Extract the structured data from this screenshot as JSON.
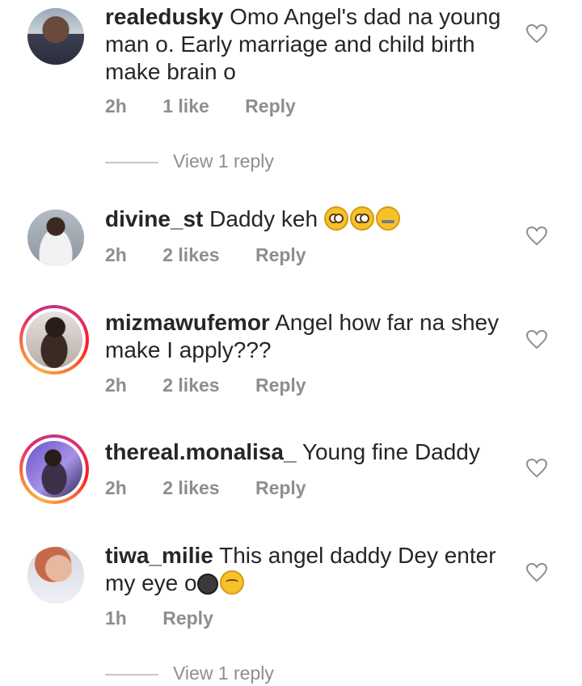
{
  "comments": [
    {
      "username": "realedusky",
      "text": "Omo Angel's dad na young man o. Early marriage and child birth make brain o",
      "time": "2h",
      "likes": "1 like",
      "reply": "Reply",
      "view_replies": "View 1 reply",
      "avatar_ring": false
    },
    {
      "username": "divine_st",
      "text": "Daddy keh",
      "emojis": [
        "flushed-face",
        "flushed-face",
        "zipper-mouth-face"
      ],
      "time": "2h",
      "likes": "2 likes",
      "reply": "Reply",
      "avatar_ring": false
    },
    {
      "username": "mizmawufemor",
      "text": "Angel how far na shey make I apply???",
      "time": "2h",
      "likes": "2 likes",
      "reply": "Reply",
      "avatar_ring": true
    },
    {
      "username": "thereal.monalisa_",
      "text": "Young fine Daddy",
      "time": "2h",
      "likes": "2 likes",
      "reply": "Reply",
      "avatar_ring": true
    },
    {
      "username": "tiwa_milie",
      "text": "This angel daddy Dey enter my eye o",
      "emojis": [
        "dark-face",
        "relieved-face"
      ],
      "time": "1h",
      "reply": "Reply",
      "view_replies": "View 1 reply",
      "avatar_ring": false
    }
  ],
  "colors": {
    "text": "#262626",
    "meta": "#8e8e8e",
    "ring_start": "#c13584",
    "ring_end": "#fcaf45"
  },
  "icons": {
    "like": "heart-outline-icon"
  }
}
